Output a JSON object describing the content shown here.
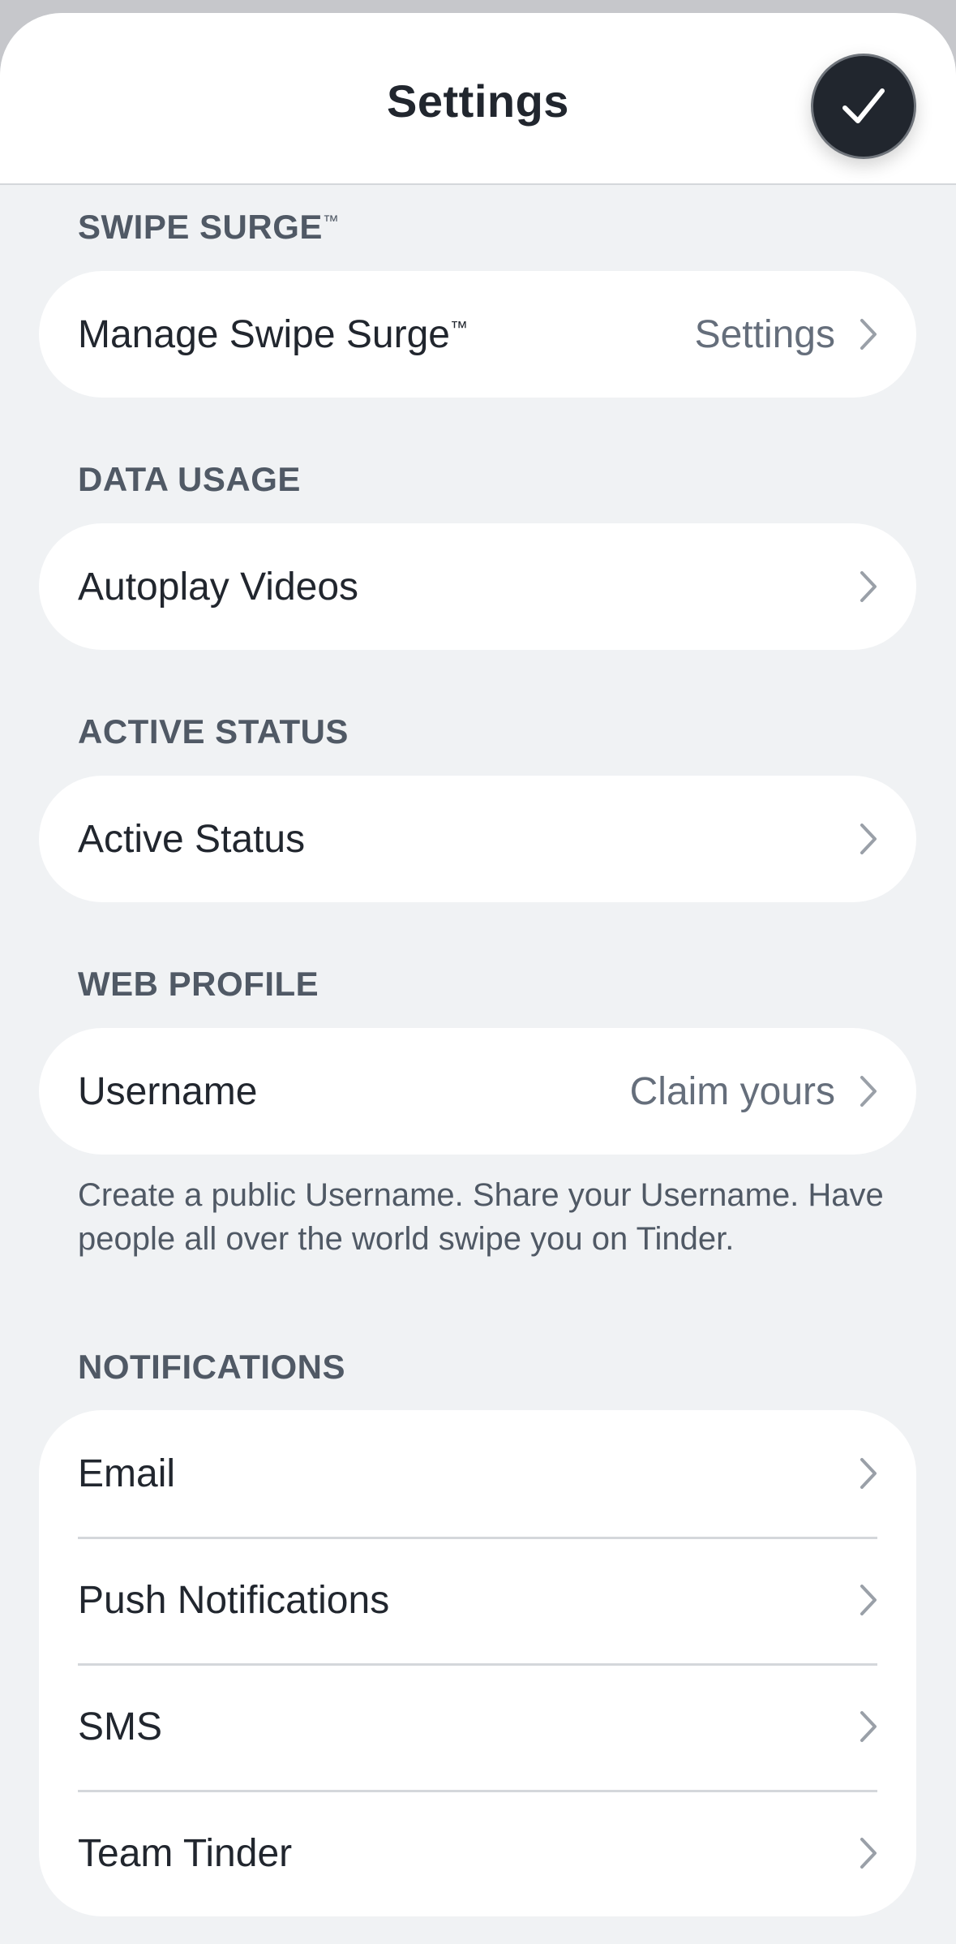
{
  "header": {
    "title": "Settings",
    "done_icon": "checkmark-icon"
  },
  "trademark": "™",
  "sections": {
    "swipe_surge": {
      "header": "SWIPE SURGE",
      "rows": [
        {
          "label": "Manage Swipe Surge",
          "value": "Settings",
          "icon": "chevron-right-icon"
        }
      ]
    },
    "data_usage": {
      "header": "DATA USAGE",
      "rows": [
        {
          "label": "Autoplay Videos",
          "value": "",
          "icon": "chevron-right-icon"
        }
      ]
    },
    "active_status": {
      "header": "ACTIVE STATUS",
      "rows": [
        {
          "label": "Active Status",
          "value": "",
          "icon": "chevron-right-icon"
        }
      ]
    },
    "web_profile": {
      "header": "WEB PROFILE",
      "rows": [
        {
          "label": "Username",
          "value": "Claim yours",
          "icon": "chevron-right-icon"
        }
      ],
      "helper": "Create a public Username. Share your Username. Have people all over the world swipe you on Tinder."
    },
    "notifications": {
      "header": "NOTIFICATIONS",
      "rows": [
        {
          "label": "Email",
          "value": "",
          "icon": "chevron-right-icon"
        },
        {
          "label": "Push Notifications",
          "value": "",
          "icon": "chevron-right-icon"
        },
        {
          "label": "SMS",
          "value": "",
          "icon": "chevron-right-icon"
        },
        {
          "label": "Team Tinder",
          "value": "",
          "icon": "chevron-right-icon"
        }
      ]
    }
  },
  "colors": {
    "background": "#f0f2f4",
    "card": "#ffffff",
    "primary_text": "#21262e",
    "secondary_text": "#656e7b",
    "section_header": "#505965",
    "done_button": "#21262e"
  }
}
